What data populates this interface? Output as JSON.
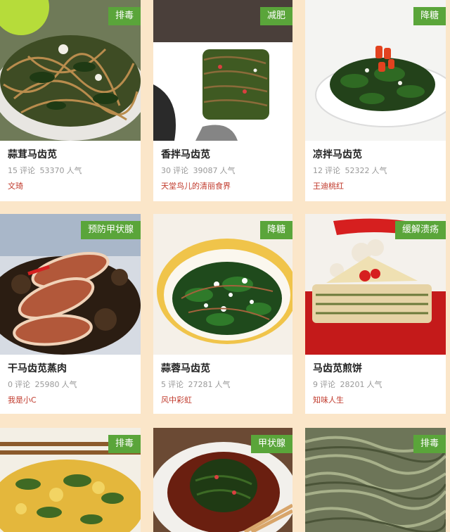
{
  "colors": {
    "background": "#fbe6c9",
    "tag": "#5aa53a",
    "author": "#c0392b",
    "meta": "#999999"
  },
  "cards": [
    {
      "tag": "排毒",
      "title": "蒜茸马齿苋",
      "comments": "15",
      "comments_label": "评论",
      "views": "53370",
      "views_label": "人气",
      "author": "文琦"
    },
    {
      "tag": "减肥",
      "title": "香拌马齿苋",
      "comments": "30",
      "comments_label": "评论",
      "views": "39087",
      "views_label": "人气",
      "author": "天堂鸟儿的清丽食界"
    },
    {
      "tag": "降糖",
      "title": "凉拌马齿苋",
      "comments": "12",
      "comments_label": "评论",
      "views": "52322",
      "views_label": "人气",
      "author": "王迪桃红"
    },
    {
      "tag": "预防甲状腺",
      "title": "干马齿苋蒸肉",
      "comments": "0",
      "comments_label": "评论",
      "views": "25980",
      "views_label": "人气",
      "author": "我是小C"
    },
    {
      "tag": "降糖",
      "title": "蒜蓉马齿苋",
      "comments": "5",
      "comments_label": "评论",
      "views": "27281",
      "views_label": "人气",
      "author": "风中彩虹"
    },
    {
      "tag": "缓解溃疡",
      "title": "马齿苋煎饼",
      "comments": "9",
      "comments_label": "评论",
      "views": "28201",
      "views_label": "人气",
      "author": "知味人生"
    },
    {
      "tag": "排毒"
    },
    {
      "tag": "甲状腺"
    },
    {
      "tag": "排毒"
    }
  ]
}
